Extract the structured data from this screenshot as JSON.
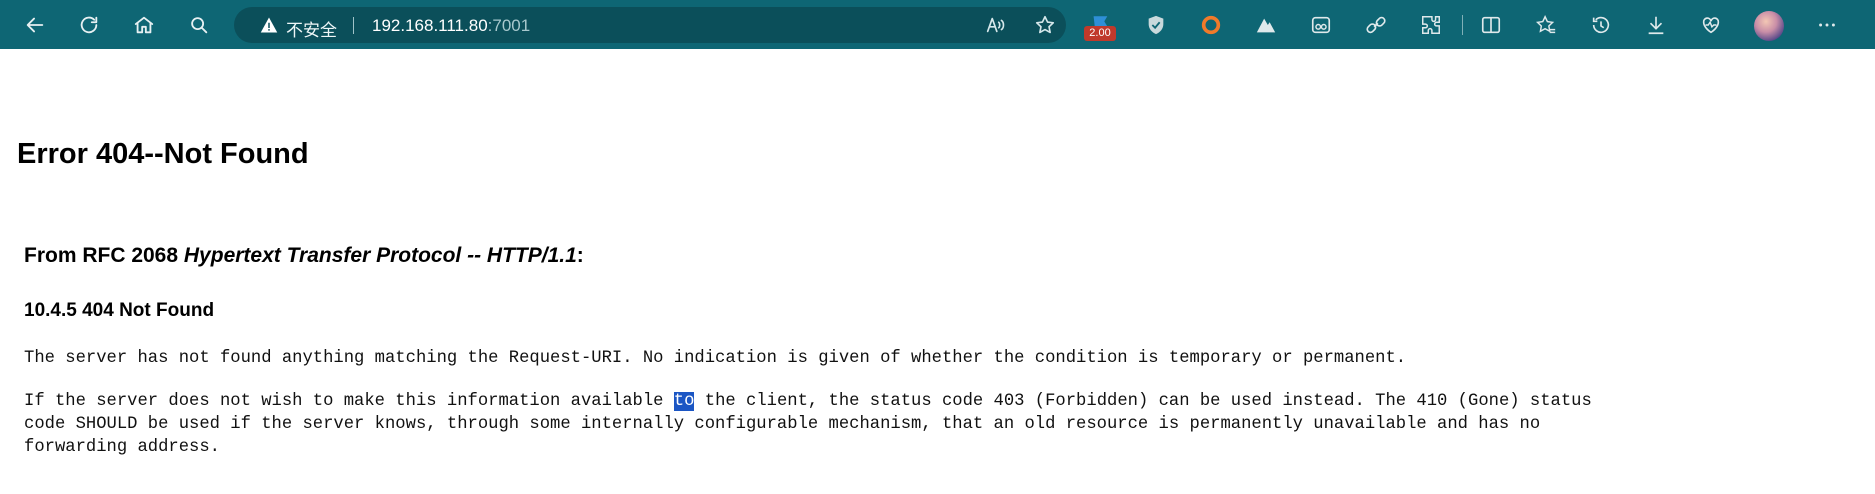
{
  "browser": {
    "security_label": "不安全",
    "url_host": "192.168.111.80",
    "url_port": ":7001",
    "extension_badge": "2.00",
    "toolbar_icons": [
      "back-icon",
      "refresh-icon",
      "home-icon",
      "search-icon",
      "warning-icon",
      "read-aloud-icon",
      "favorite-star-icon",
      "extension-icons",
      "split-screen-icon",
      "favorites-icon",
      "history-icon",
      "downloads-icon",
      "health-icon",
      "profile-avatar",
      "more-icon"
    ]
  },
  "page": {
    "heading": "Error 404--Not Found",
    "rfc_prefix": "From RFC 2068 ",
    "rfc_title": "Hypertext Transfer Protocol -- HTTP/1.1",
    "rfc_suffix": ":",
    "section_heading": "10.4.5 404 Not Found",
    "paragraph1": "The server has not found anything matching the Request-URI. No indication is given of whether the condition is temporary or permanent.",
    "paragraph2_before": "If the server does not wish to make this information available ",
    "paragraph2_highlight": "to",
    "paragraph2_line1_after": " the client, the status code 403 (Forbidden) can be used instead. The 410 (Gone) status",
    "paragraph2_line2": "code SHOULD be used if the server knows, through some internally configurable mechanism, that an old resource is permanently unavailable and has no",
    "paragraph2_line3": "forwarding address."
  }
}
